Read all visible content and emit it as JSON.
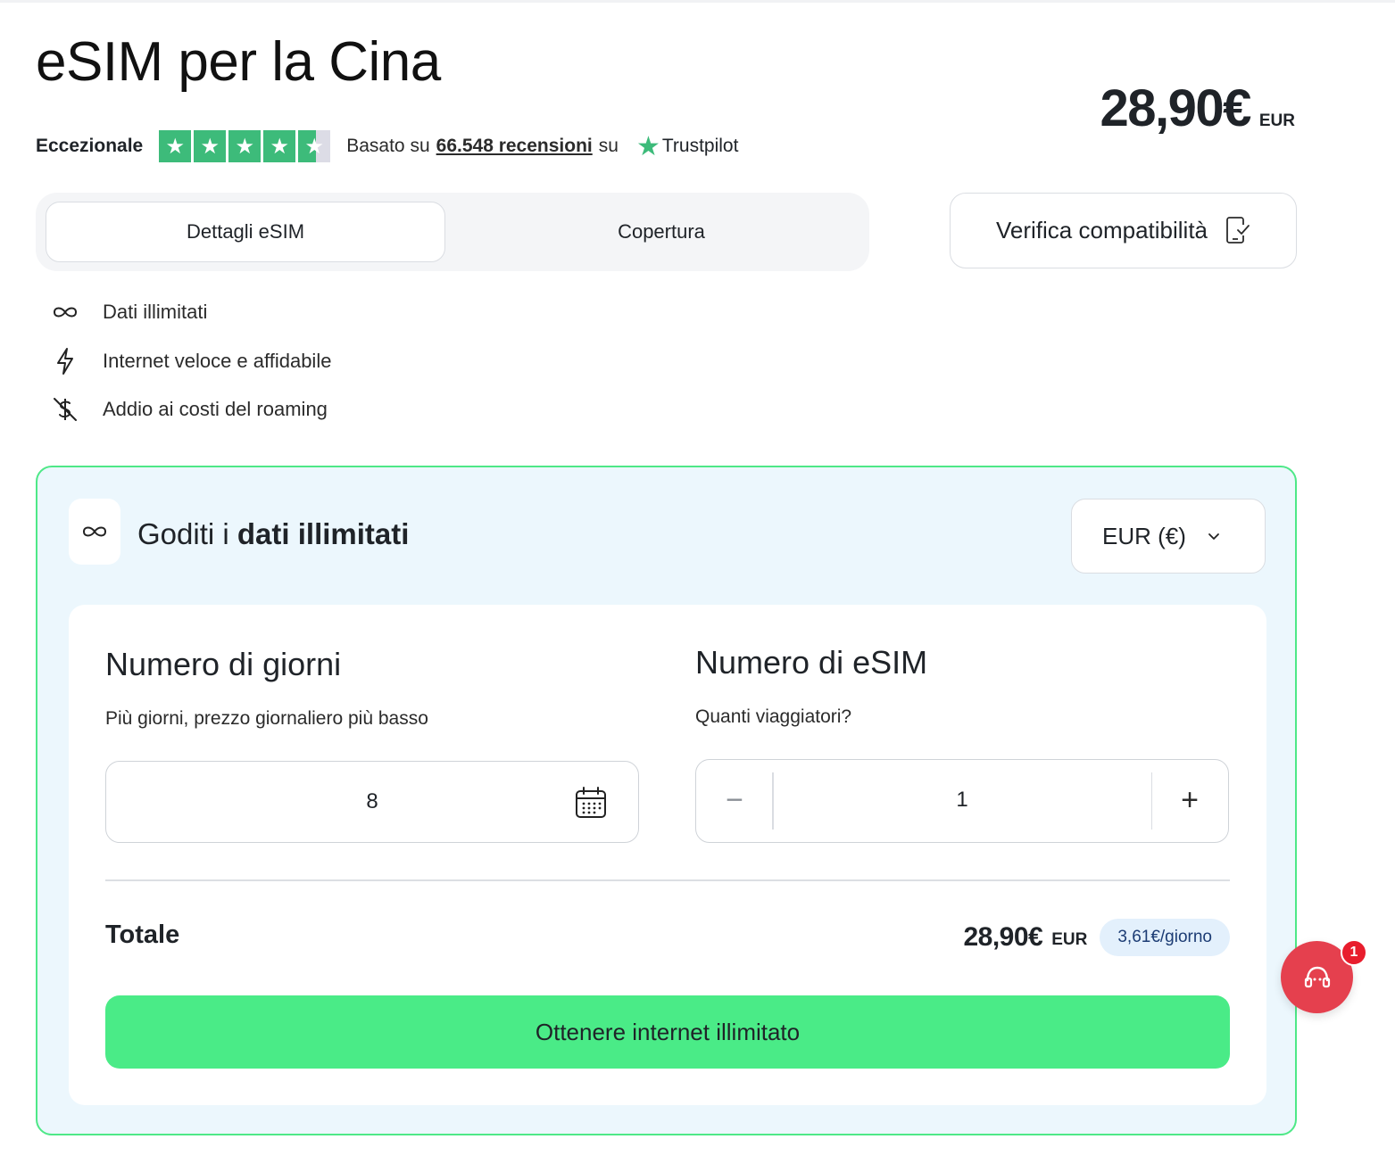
{
  "page": {
    "title": "eSIM per la Cina",
    "price": "28,90€",
    "price_currency": "EUR"
  },
  "rating": {
    "label": "Eccezionale",
    "stars_value": 4.5,
    "stars_max": 5,
    "based_prefix": "Basato su",
    "reviews_link": "66.548 recensioni",
    "based_suffix": "su",
    "provider": "Trustpilot"
  },
  "tabs": [
    {
      "label": "Dettagli eSIM",
      "active": true
    },
    {
      "label": "Copertura",
      "active": false
    }
  ],
  "verify_button": {
    "label": "Verifica compatibilità"
  },
  "features": [
    {
      "icon": "infinity-icon",
      "label": "Dati illimitati"
    },
    {
      "icon": "lightning-icon",
      "label": "Internet veloce e affidabile"
    },
    {
      "icon": "no-dollar-icon",
      "label": "Addio ai costi del roaming"
    }
  ],
  "plan": {
    "title_prefix": "Goditi i",
    "title_bold": "dati illimitati",
    "currency_select": "EUR (€)",
    "days": {
      "heading": "Numero di giorni",
      "subheading": "Più giorni, prezzo giornaliero più basso",
      "value": "8"
    },
    "esims": {
      "heading": "Numero di eSIM",
      "subheading": "Quanti viaggiatori?",
      "value": "1",
      "minus_label": "−",
      "plus_label": "+"
    },
    "total": {
      "label": "Totale",
      "amount": "28,90€",
      "currency": "EUR",
      "per_day": "3,61€/giorno"
    },
    "cta": "Ottenere internet illimitato"
  },
  "support": {
    "icon": "headset-icon",
    "badge_count": "1"
  },
  "colors": {
    "accent_green": "#4aeb87",
    "card_border": "#4ee887",
    "card_bg": "#ecf7fd",
    "trustpilot_green": "#3dbb7a",
    "support_red": "#e5404e"
  }
}
